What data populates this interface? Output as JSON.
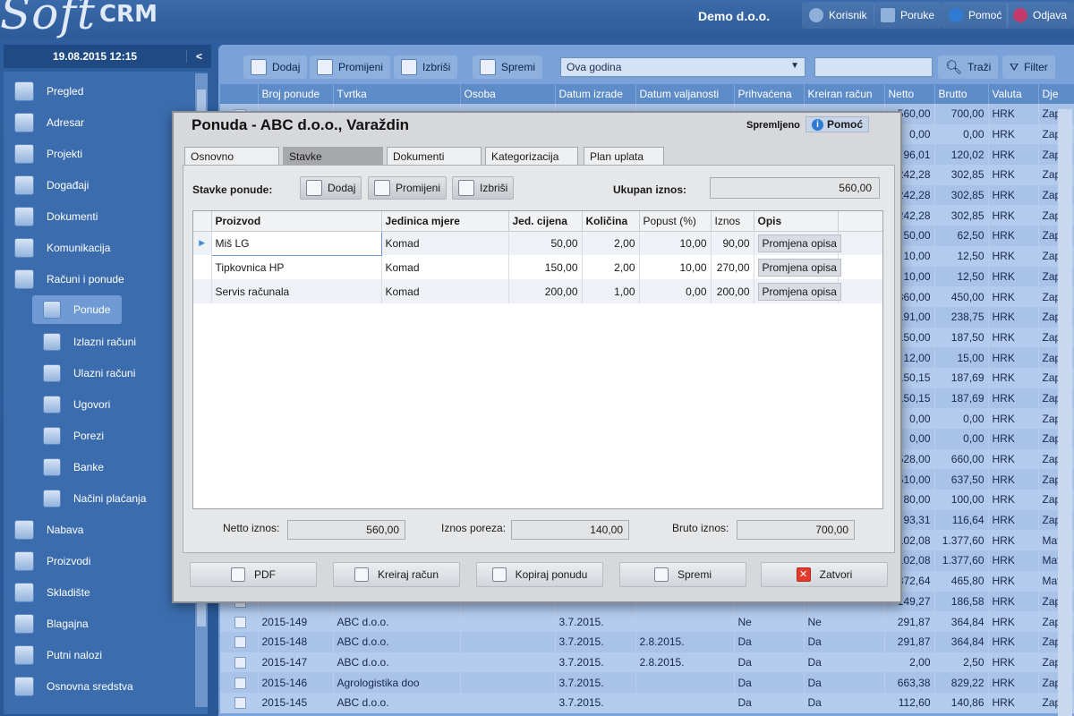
{
  "header": {
    "logo_soft": "Soft",
    "logo_crm": "CRM",
    "company": "Demo d.o.o.",
    "buttons": [
      {
        "label": "Korisnik",
        "icon": "user-icon"
      },
      {
        "label": "Poruke",
        "icon": "mail-icon"
      },
      {
        "label": "Pomoć",
        "icon": "info-icon"
      },
      {
        "label": "Odjava",
        "icon": "power-icon"
      }
    ]
  },
  "sidebar": {
    "datetime": "19.08.2015 12:15",
    "collapse": "<",
    "items": [
      {
        "label": "Pregled",
        "icon": "overview-icon"
      },
      {
        "label": "Adresar",
        "icon": "address-book-icon"
      },
      {
        "label": "Projekti",
        "icon": "projects-icon"
      },
      {
        "label": "Događaji",
        "icon": "calendar-icon"
      },
      {
        "label": "Dokumenti",
        "icon": "documents-icon"
      },
      {
        "label": "Komunikacija",
        "icon": "communication-icon"
      },
      {
        "label": "Računi i ponude",
        "icon": "invoices-icon"
      },
      {
        "label": "Ponude",
        "icon": "offers-icon",
        "sub": true,
        "active": true
      },
      {
        "label": "Izlazni računi",
        "icon": "outgoing-invoice-icon",
        "sub": true
      },
      {
        "label": "Ulazni računi",
        "icon": "incoming-invoice-icon",
        "sub": true
      },
      {
        "label": "Ugovori",
        "icon": "contracts-icon",
        "sub": true
      },
      {
        "label": "Porezi",
        "icon": "dollar-icon",
        "sub": true
      },
      {
        "label": "Banke",
        "icon": "bank-icon",
        "sub": true
      },
      {
        "label": "Načini plaćanja",
        "icon": "payment-methods-icon",
        "sub": true
      },
      {
        "label": "Nabava",
        "icon": "procurement-icon"
      },
      {
        "label": "Proizvodi",
        "icon": "products-icon"
      },
      {
        "label": "Skladište",
        "icon": "warehouse-icon"
      },
      {
        "label": "Blagajna",
        "icon": "cash-register-icon"
      },
      {
        "label": "Putni nalozi",
        "icon": "travel-order-icon"
      },
      {
        "label": "Osnovna sredstva",
        "icon": "fixed-assets-icon"
      }
    ]
  },
  "toolbar": {
    "add": "Dodaj",
    "edit": "Promijeni",
    "delete": "Izbriši",
    "save": "Spremi",
    "period": "Ova godina",
    "search_btn": "Traži",
    "filter_btn": "Filter"
  },
  "grid": {
    "columns": [
      "Broj ponude",
      "Tvrtka",
      "Osoba",
      "Datum izrade",
      "Datum valjanosti",
      "Prihvaćena",
      "Kreiran račun",
      "Netto",
      "Brutto",
      "Valuta",
      "Dje"
    ],
    "rows": [
      [
        "",
        "",
        "",
        "",
        "",
        "",
        "",
        "560,00",
        "700,00",
        "HRK",
        "Zap"
      ],
      [
        "",
        "",
        "",
        "",
        "",
        "",
        "",
        "0,00",
        "0,00",
        "HRK",
        "Zap"
      ],
      [
        "",
        "",
        "",
        "",
        "",
        "",
        "",
        "96,01",
        "120,02",
        "HRK",
        "Zap"
      ],
      [
        "",
        "",
        "",
        "",
        "",
        "",
        "",
        "242,28",
        "302,85",
        "HRK",
        "Zap"
      ],
      [
        "",
        "",
        "",
        "",
        "",
        "",
        "",
        "242,28",
        "302,85",
        "HRK",
        "Zap"
      ],
      [
        "",
        "",
        "",
        "",
        "",
        "",
        "",
        "242,28",
        "302,85",
        "HRK",
        "Zap"
      ],
      [
        "",
        "",
        "",
        "",
        "",
        "",
        "",
        "50,00",
        "62,50",
        "HRK",
        "Zap"
      ],
      [
        "",
        "",
        "",
        "",
        "",
        "",
        "",
        "10,00",
        "12,50",
        "HRK",
        "Zap"
      ],
      [
        "",
        "",
        "",
        "",
        "",
        "",
        "",
        "10,00",
        "12,50",
        "HRK",
        "Zap"
      ],
      [
        "",
        "",
        "",
        "",
        "",
        "",
        "",
        "360,00",
        "450,00",
        "HRK",
        "Zap"
      ],
      [
        "",
        "",
        "",
        "",
        "",
        "",
        "",
        "191,00",
        "238,75",
        "HRK",
        "Zap"
      ],
      [
        "",
        "",
        "",
        "",
        "",
        "",
        "",
        "150,00",
        "187,50",
        "HRK",
        "Zap"
      ],
      [
        "",
        "",
        "",
        "",
        "",
        "",
        "",
        "12,00",
        "15,00",
        "HRK",
        "Zap"
      ],
      [
        "",
        "",
        "",
        "",
        "",
        "",
        "",
        "150,15",
        "187,69",
        "HRK",
        "Zap"
      ],
      [
        "",
        "",
        "",
        "",
        "",
        "",
        "",
        "150,15",
        "187,69",
        "HRK",
        "Zap"
      ],
      [
        "",
        "",
        "",
        "",
        "",
        "",
        "",
        "0,00",
        "0,00",
        "HRK",
        "Zap"
      ],
      [
        "",
        "",
        "",
        "",
        "",
        "",
        "",
        "0,00",
        "0,00",
        "HRK",
        "Zap"
      ],
      [
        "",
        "",
        "",
        "",
        "",
        "",
        "",
        "528,00",
        "660,00",
        "HRK",
        "Zap"
      ],
      [
        "",
        "",
        "",
        "",
        "",
        "",
        "",
        "510,00",
        "637,50",
        "HRK",
        "Zap"
      ],
      [
        "",
        "",
        "",
        "",
        "",
        "",
        "",
        "80,00",
        "100,00",
        "HRK",
        "Zap"
      ],
      [
        "",
        "",
        "",
        "",
        "",
        "",
        "",
        "93,31",
        "116,64",
        "HRK",
        "Zap"
      ],
      [
        "",
        "",
        "",
        "",
        "",
        "",
        "",
        "102,08",
        "1.377,60",
        "HRK",
        "Mat"
      ],
      [
        "",
        "",
        "",
        "",
        "",
        "",
        "",
        "102,08",
        "1.377,60",
        "HRK",
        "Mat"
      ],
      [
        "",
        "",
        "",
        "",
        "",
        "",
        "",
        "372,64",
        "465,80",
        "HRK",
        "Mat"
      ],
      [
        "",
        "",
        "",
        "",
        "",
        "",
        "",
        "149,27",
        "186,58",
        "HRK",
        "Zap"
      ],
      [
        "2015-149",
        "ABC d.o.o.",
        "",
        "3.7.2015.",
        "",
        "Ne",
        "Ne",
        "291,87",
        "364,84",
        "HRK",
        "Zap"
      ],
      [
        "2015-148",
        "ABC d.o.o.",
        "",
        "3.7.2015.",
        "2.8.2015.",
        "Da",
        "Da",
        "291,87",
        "364,84",
        "HRK",
        "Zap"
      ],
      [
        "2015-147",
        "ABC d.o.o.",
        "",
        "3.7.2015.",
        "2.8.2015.",
        "Da",
        "Da",
        "2,00",
        "2,50",
        "HRK",
        "Zap"
      ],
      [
        "2015-146",
        "Agrologistika doo",
        "",
        "3.7.2015.",
        "",
        "Da",
        "Da",
        "663,38",
        "829,22",
        "HRK",
        "Zap"
      ],
      [
        "2015-145",
        "ABC d.o.o.",
        "",
        "3.7.2015.",
        "",
        "Da",
        "Da",
        "112,60",
        "140,86",
        "HRK",
        "Zap"
      ]
    ]
  },
  "modal": {
    "title": "Ponuda - ABC d.o.o., Varaždin",
    "status": "Spremljeno",
    "help": "Pomoć",
    "tabs": [
      "Osnovno",
      "Stavke",
      "Dokumenti",
      "Kategorizacija",
      "Plan uplata"
    ],
    "active_tab": "Stavke",
    "items_label": "Stavke ponude:",
    "add": "Dodaj",
    "edit": "Promijeni",
    "delete": "Izbriši",
    "total_label": "Ukupan iznos:",
    "total_value": "560,00",
    "columns": [
      "Proizvod",
      "Jedinica mjere",
      "Jed. cijena",
      "Količina",
      "Popust (%)",
      "Iznos",
      "Opis"
    ],
    "items": [
      [
        "Miš LG",
        "Komad",
        "50,00",
        "2,00",
        "10,00",
        "90,00",
        "Promjena opisa"
      ],
      [
        "Tipkovnica HP",
        "Komad",
        "150,00",
        "2,00",
        "10,00",
        "270,00",
        "Promjena opisa"
      ],
      [
        "Servis računala",
        "Komad",
        "200,00",
        "1,00",
        "0,00",
        "200,00",
        "Promjena opisa"
      ]
    ],
    "netto_label": "Netto iznos:",
    "netto_value": "560,00",
    "tax_label": "Iznos poreza:",
    "tax_value": "140,00",
    "brutto_label": "Bruto iznos:",
    "brutto_value": "700,00",
    "footer": {
      "pdf": "PDF",
      "create_invoice": "Kreiraj račun",
      "copy_offer": "Kopiraj ponudu",
      "save": "Spremi",
      "close": "Zatvori"
    }
  },
  "colors": {
    "brand_blue": "#2f5f9e",
    "panel_blue": "#7aa2d8",
    "close_red": "#e23b2e",
    "info_blue": "#2f7bd3"
  }
}
